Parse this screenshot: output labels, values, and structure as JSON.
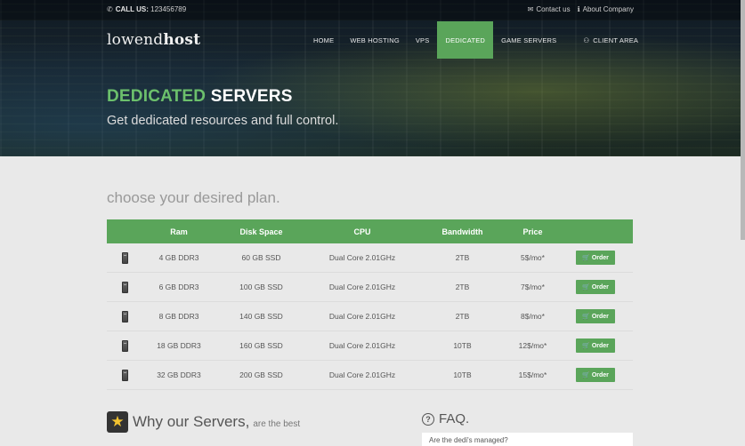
{
  "topbar": {
    "call_label": "CALL US:",
    "phone": "123456789",
    "contact": "Contact us",
    "about": "About Company"
  },
  "logo": {
    "part1": "lowend",
    "part2": "host"
  },
  "nav": {
    "items": [
      "HOME",
      "WEB HOSTING",
      "VPS",
      "DEDICATED",
      "GAME SERVERS"
    ],
    "client": "CLIENT AREA",
    "active": "DEDICATED"
  },
  "hero": {
    "title_green": "DEDICATED",
    "title_white": "SERVERS",
    "subtitle": "Get dedicated resources and full control."
  },
  "plans": {
    "title": "choose your desired plan.",
    "headers": [
      "Ram",
      "Disk Space",
      "CPU",
      "Bandwidth",
      "Price"
    ],
    "order_label": "Order",
    "rows": [
      {
        "ram": "4 GB DDR3",
        "disk": "60 GB SSD",
        "cpu": "Dual Core 2.01GHz",
        "bw": "2TB",
        "price": "5$/mo*"
      },
      {
        "ram": "6 GB DDR3",
        "disk": "100 GB SSD",
        "cpu": "Dual Core 2.01GHz",
        "bw": "2TB",
        "price": "7$/mo*"
      },
      {
        "ram": "8 GB DDR3",
        "disk": "140 GB SSD",
        "cpu": "Dual Core 2.01GHz",
        "bw": "2TB",
        "price": "8$/mo*"
      },
      {
        "ram": "18 GB DDR3",
        "disk": "160 GB SSD",
        "cpu": "Dual Core 2.01GHz",
        "bw": "10TB",
        "price": "12$/mo*"
      },
      {
        "ram": "32 GB DDR3",
        "disk": "200 GB SSD",
        "cpu": "Dual Core 2.01GHz",
        "bw": "10TB",
        "price": "15$/mo*"
      }
    ]
  },
  "why": {
    "title": "Why our Servers,",
    "sub": "are the best"
  },
  "faq": {
    "title": "FAQ.",
    "q1": "Are the dedi's managed?"
  },
  "colors": {
    "accent": "#5aa55a",
    "title_green": "#6cc06c"
  }
}
